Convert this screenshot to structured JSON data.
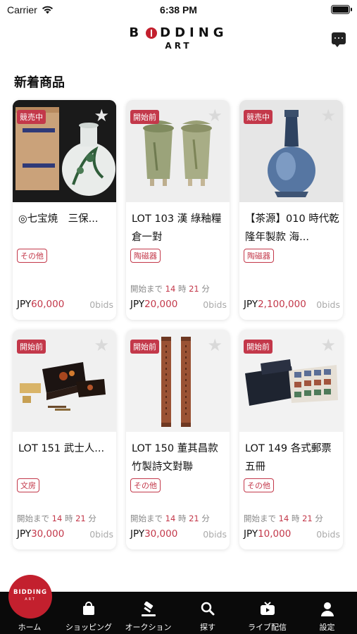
{
  "status_bar": {
    "carrier": "Carrier",
    "time": "6:38 PM"
  },
  "header": {
    "logo_text": "BIDDING",
    "logo_sub": "ART",
    "chat_icon": "chat-bubble-icon"
  },
  "section": {
    "title": "新着商品"
  },
  "colors": {
    "accent": "#c3384a",
    "brand_red": "#c3202e",
    "tab_bar_bg": "#0a0a0a"
  },
  "countdown_labels": {
    "prefix": "開始まで",
    "hour_unit": "時",
    "minute_unit": "分"
  },
  "products": [
    {
      "status": "競売中",
      "title": "◎七宝焼　三保...",
      "category": "その他",
      "currency": "JPY",
      "price": "60,000",
      "bids": "0bids",
      "hours": "",
      "minutes": ""
    },
    {
      "status": "開始前",
      "title": "LOT 103 漢 綠釉糧倉一對",
      "category": "陶磁器",
      "currency": "JPY",
      "price": "20,000",
      "bids": "0bids",
      "hours": "14",
      "minutes": "21"
    },
    {
      "status": "競売中",
      "title": "【茶源】010 時代乾隆年製款 海...",
      "category": "陶磁器",
      "currency": "JPY",
      "price": "2,100,000",
      "bids": "0bids",
      "hours": "",
      "minutes": ""
    },
    {
      "status": "開始前",
      "title": "LOT 151 武士人...",
      "category": "文房",
      "currency": "JPY",
      "price": "30,000",
      "bids": "0bids",
      "hours": "14",
      "minutes": "21"
    },
    {
      "status": "開始前",
      "title": "LOT 150 董其昌款竹製詩文對聯",
      "category": "その他",
      "currency": "JPY",
      "price": "30,000",
      "bids": "0bids",
      "hours": "14",
      "minutes": "21"
    },
    {
      "status": "開始前",
      "title": "LOT 149 各式郵票五冊",
      "category": "その他",
      "currency": "JPY",
      "price": "10,000",
      "bids": "0bids",
      "hours": "14",
      "minutes": "21"
    }
  ],
  "tabs": [
    {
      "label": "ホーム",
      "icon": "home-logo-icon"
    },
    {
      "label": "ショッピング",
      "icon": "shopping-bag-icon"
    },
    {
      "label": "オークション",
      "icon": "gavel-icon"
    },
    {
      "label": "探す",
      "icon": "search-icon"
    },
    {
      "label": "ライブ配信",
      "icon": "live-stream-icon"
    },
    {
      "label": "設定",
      "icon": "user-icon"
    }
  ],
  "home_badge": {
    "main": "BIDDING",
    "sub": "ART"
  }
}
